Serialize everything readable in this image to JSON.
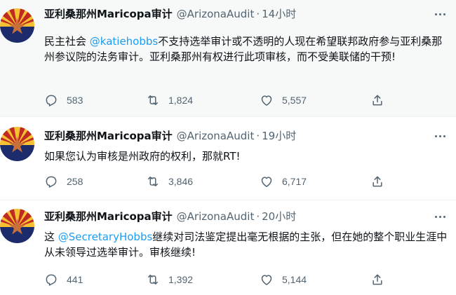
{
  "tweets": [
    {
      "name": "亚利桑那州Maricopa审计",
      "handle": "@ArizonaAudit",
      "dot": "·",
      "time": "14小时",
      "text_before": "民主社会 ",
      "mention": "@katiehobbs",
      "text_after": "不支持选举审计或不透明的人现在希望联邦政府参与亚利桑那州参议院的法务审计。亚利桑那州有权进行此项审核，而不受美联储的干预!",
      "replies": "583",
      "retweets": "1,824",
      "likes": "5,557"
    },
    {
      "name": "亚利桑那州Maricopa审计",
      "handle": "@ArizonaAudit",
      "dot": "·",
      "time": "19小时",
      "text_before": "如果您认为审核是州政府的权利，那就RT!",
      "mention": "",
      "text_after": "",
      "replies": "258",
      "retweets": "3,846",
      "likes": "6,717"
    },
    {
      "name": "亚利桑那州Maricopa审计",
      "handle": "@ArizonaAudit",
      "dot": "·",
      "time": "20小时",
      "text_before": "这 ",
      "mention": "@SecretaryHobbs",
      "text_after": "继续对司法鉴定提出毫无根据的主张，但在她的整个职业生涯中从未领导过选举审计。审核继续!",
      "replies": "441",
      "retweets": "1,392",
      "likes": "5,144"
    }
  ],
  "icons": {
    "reply": "reply-icon",
    "retweet": "retweet-icon",
    "like": "heart-icon",
    "share": "share-icon",
    "more": "more-options-icon",
    "avatar": "arizona-flag-avatar"
  },
  "colors": {
    "name": "#0f1419",
    "secondary": "#536471",
    "mention": "#1d9bf0",
    "highlight_bg": "#f7f9f9",
    "flag_red": "#bf2b22",
    "flag_yellow": "#f6c032",
    "flag_blue": "#1b2b6b",
    "flag_copper": "#c7703a"
  }
}
